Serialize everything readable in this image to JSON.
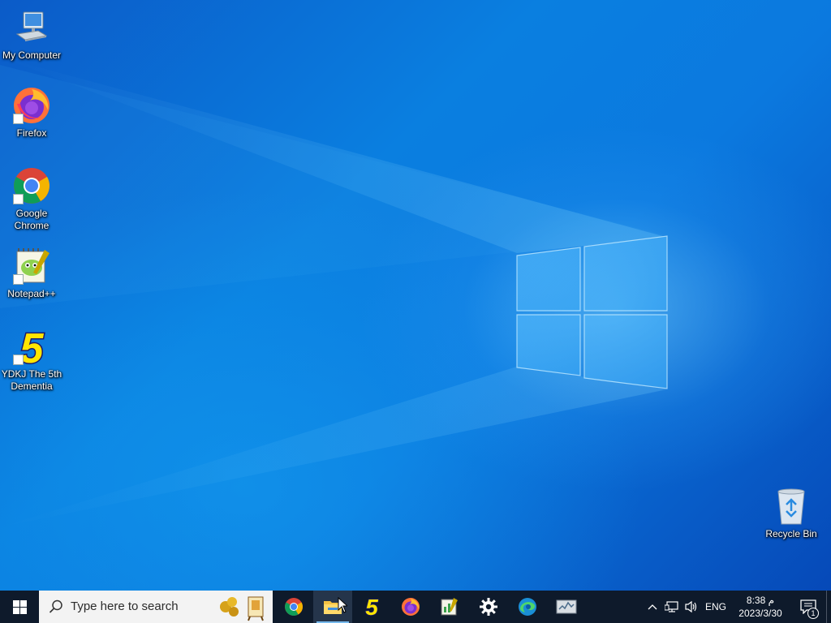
{
  "desktop": {
    "icons": [
      {
        "label": "My Computer",
        "icon": "my-computer-icon"
      },
      {
        "label": "Firefox",
        "icon": "firefox-icon"
      },
      {
        "label": "Google Chrome",
        "icon": "chrome-icon"
      },
      {
        "label": "Notepad++",
        "icon": "notepadpp-icon"
      },
      {
        "label": "YDKJ The 5th Dementia",
        "icon": "ydkj-icon"
      },
      {
        "label": "Recycle Bin",
        "icon": "recycle-bin-icon"
      }
    ]
  },
  "taskbar": {
    "search": {
      "placeholder": "Type here to search"
    },
    "apps": [
      {
        "name": "Google Chrome",
        "icon": "chrome-icon",
        "active": false
      },
      {
        "name": "File Explorer",
        "icon": "file-explorer-icon",
        "active": true
      },
      {
        "name": "YDKJ",
        "icon": "ydkj-icon",
        "active": false
      },
      {
        "name": "Firefox",
        "icon": "firefox-icon",
        "active": false
      },
      {
        "name": "Task editor",
        "icon": "notepad-chart-icon",
        "active": false
      },
      {
        "name": "Settings",
        "icon": "gear-icon",
        "active": false
      },
      {
        "name": "Microsoft Edge",
        "icon": "edge-icon",
        "active": false
      },
      {
        "name": "Resource Monitor",
        "icon": "monitor-icon",
        "active": false
      }
    ],
    "tray": {
      "language": "ENG",
      "time": "8:38 م",
      "date": "2023/3/30",
      "notification_count": "1"
    }
  },
  "colors": {
    "taskbar_bg": "#0e1a2b",
    "accent": "#76b9ed",
    "wallpaper": "#0a7fe0"
  }
}
